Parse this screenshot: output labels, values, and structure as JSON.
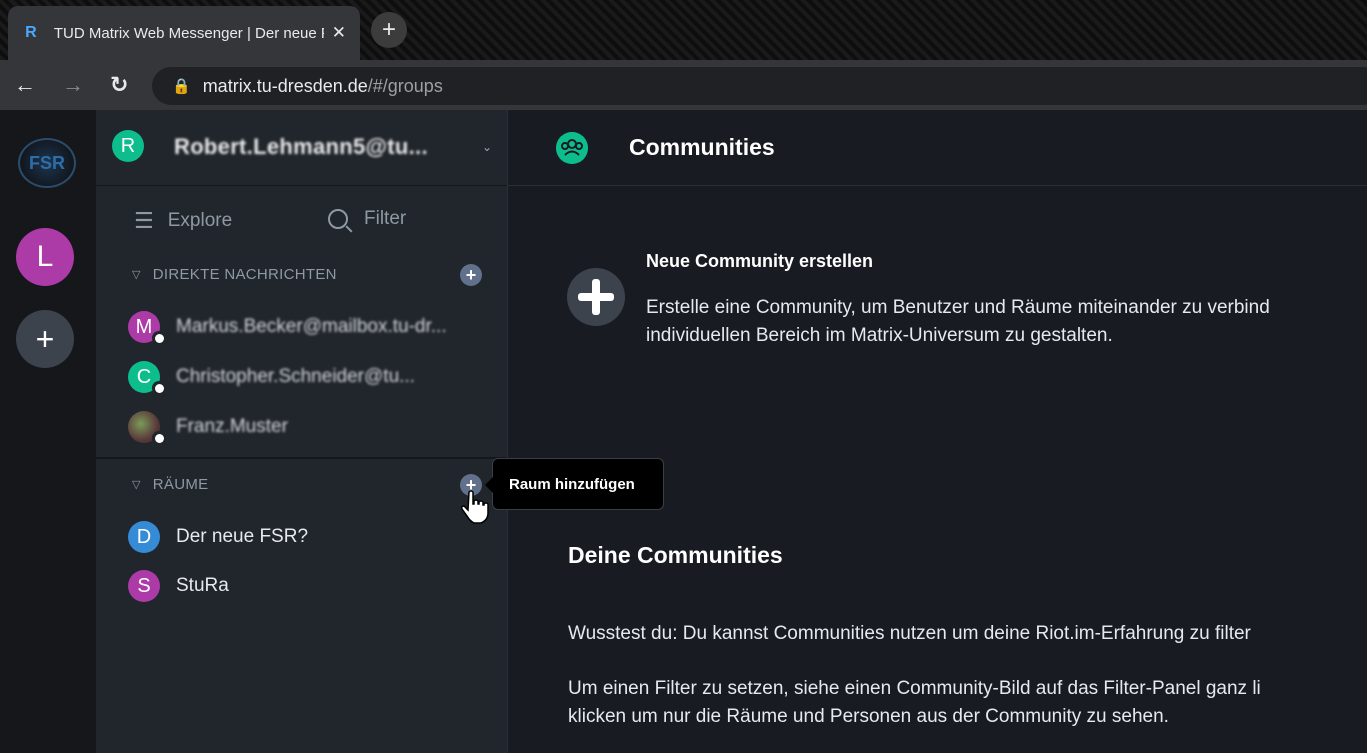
{
  "browser": {
    "tab_title": "TUD Matrix Web Messenger | Der neue FSR?",
    "tab_close": "✕",
    "new_tab": "+",
    "url_host": "matrix.tu-dresden.de",
    "url_path": "/#/groups"
  },
  "rail": {
    "logo_text": "FSR",
    "community_initial": "L",
    "add_label": "+"
  },
  "user": {
    "initial": "R",
    "name": "Robert.Lehmann5@tu..."
  },
  "search": {
    "explore": "Explore",
    "filter": "Filter"
  },
  "direct_messages": {
    "header": "DIREKTE NACHRICHTEN",
    "items": [
      {
        "initial": "M",
        "name": "Markus.Becker@mailbox.tu-dr...",
        "color": "#ac3ba8"
      },
      {
        "initial": "C",
        "name": "Christopher.Schneider@tu...",
        "color": "#0dbd8b"
      },
      {
        "initial": "",
        "name": "Franz.Muster",
        "color": "#6a5a5a"
      }
    ]
  },
  "rooms": {
    "header": "RÄUME",
    "items": [
      {
        "initial": "D",
        "name": "Der neue FSR?",
        "color": "#368bd6"
      },
      {
        "initial": "S",
        "name": "StuRa",
        "color": "#ac3ba8"
      }
    ]
  },
  "tooltip": "Raum hinzufügen",
  "main": {
    "title": "Communities",
    "create_title": "Neue Community erstellen",
    "create_desc_1": "Erstelle eine Community, um Benutzer und Räume miteinander zu verbind",
    "create_desc_2": "individuellen Bereich im Matrix-Universum zu gestalten.",
    "your_communities": "Deine Communities",
    "tip_1": "Wusstest du: Du kannst Communities nutzen um deine Riot.im-Erfahrung zu filter",
    "tip_2a": "Um einen Filter zu setzen, siehe einen Community-Bild auf das Filter-Panel ganz li",
    "tip_2b": "klicken um nur die Räume und Personen aus der Community zu sehen."
  },
  "colors": {
    "accent": "#0dbd8b",
    "panel_bg": "#21262c",
    "main_bg": "#181b21"
  }
}
